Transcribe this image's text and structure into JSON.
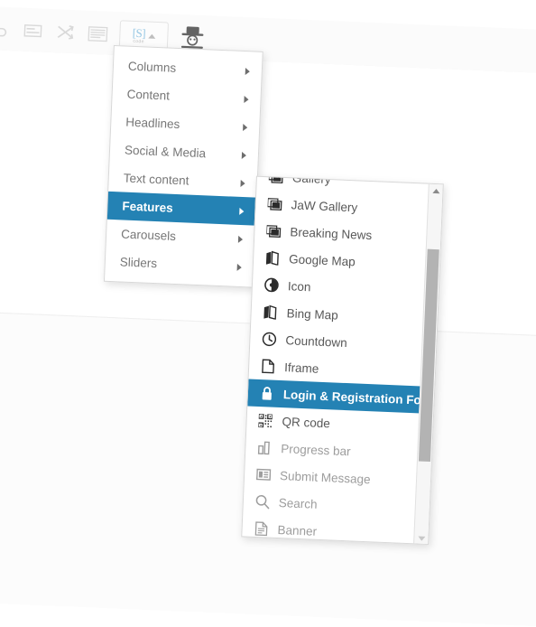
{
  "toolbar": {
    "icons": [
      {
        "name": "undo-icon",
        "label": ""
      },
      {
        "name": "list-block-icon",
        "label": ""
      },
      {
        "name": "shuffle-icon",
        "label": ""
      },
      {
        "name": "text-block-icon",
        "label": ""
      }
    ],
    "code_button": {
      "name": "source-code-button",
      "symbol": "[S]",
      "caption": "code"
    },
    "spy_button": {
      "name": "spy-icon",
      "label": ""
    }
  },
  "main_menu": {
    "name": "block-category-menu",
    "items": [
      {
        "label": "Columns",
        "active": false
      },
      {
        "label": "Content",
        "active": false
      },
      {
        "label": "Headlines",
        "active": false
      },
      {
        "label": "Social & Media",
        "active": false
      },
      {
        "label": "Text content",
        "active": false
      },
      {
        "label": "Features",
        "active": true
      },
      {
        "label": "Carousels",
        "active": false
      },
      {
        "label": "Sliders",
        "active": false
      }
    ]
  },
  "sub_menu": {
    "name": "features-submenu",
    "items": [
      {
        "label": "Gallery",
        "icon": "gallery-icon",
        "active": false,
        "dim": false,
        "clipped": true
      },
      {
        "label": "JaW Gallery",
        "icon": "gallery-icon",
        "active": false,
        "dim": false
      },
      {
        "label": "Breaking News",
        "icon": "gallery-icon",
        "active": false,
        "dim": false
      },
      {
        "label": "Google Map",
        "icon": "map-icon",
        "active": false,
        "dim": false
      },
      {
        "label": "Icon",
        "icon": "circle-dot-icon",
        "active": false,
        "dim": false
      },
      {
        "label": "Bing Map",
        "icon": "map-icon",
        "active": false,
        "dim": false
      },
      {
        "label": "Countdown",
        "icon": "clock-icon",
        "active": false,
        "dim": false
      },
      {
        "label": "Iframe",
        "icon": "page-icon",
        "active": false,
        "dim": false
      },
      {
        "label": "Login & Registration Form",
        "icon": "lock-icon",
        "active": true,
        "dim": false
      },
      {
        "label": "QR code",
        "icon": "qr-code-icon",
        "active": false,
        "dim": false
      },
      {
        "label": "Progress bar",
        "icon": "bar-chart-icon",
        "active": false,
        "dim": true
      },
      {
        "label": "Submit Message",
        "icon": "message-icon",
        "active": false,
        "dim": true
      },
      {
        "label": "Search",
        "icon": "search-icon",
        "active": false,
        "dim": true
      },
      {
        "label": "Banner",
        "icon": "document-icon",
        "active": false,
        "dim": true
      }
    ],
    "scrollbar": {
      "name": "submenu-scrollbar",
      "up_arrow": "▲",
      "down_arrow": "▼"
    }
  },
  "colors": {
    "accent": "#2482b4",
    "menu_text": "#777777",
    "submenu_text": "#585858",
    "dim_text": "#9d9d9d"
  }
}
